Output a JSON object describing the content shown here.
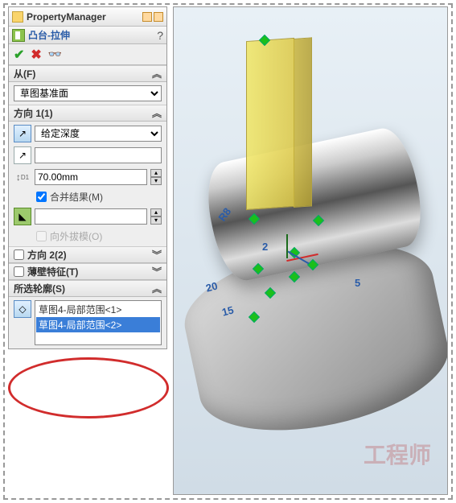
{
  "header": {
    "title": "PropertyManager"
  },
  "feature": {
    "name": "凸台-拉伸"
  },
  "groups": {
    "from": {
      "label": "从(F)",
      "value": "草图基准面"
    },
    "dir1": {
      "label": "方向 1(1)",
      "end_condition": "给定深度",
      "depth": "70.00mm",
      "merge": "合并结果(M)",
      "draft_outward": "向外拔模(O)"
    },
    "dir2": {
      "label": "方向 2(2)"
    },
    "thin": {
      "label": "薄壁特征(T)"
    },
    "contours": {
      "label": "所选轮廓(S)",
      "items": [
        "草图4-局部范围<1>",
        "草图4-局部范围<2>"
      ]
    }
  },
  "viewport": {
    "dims": {
      "r": "R8",
      "a": "20",
      "b": "15",
      "c": "5",
      "d": "2"
    },
    "watermark": "工程师"
  }
}
